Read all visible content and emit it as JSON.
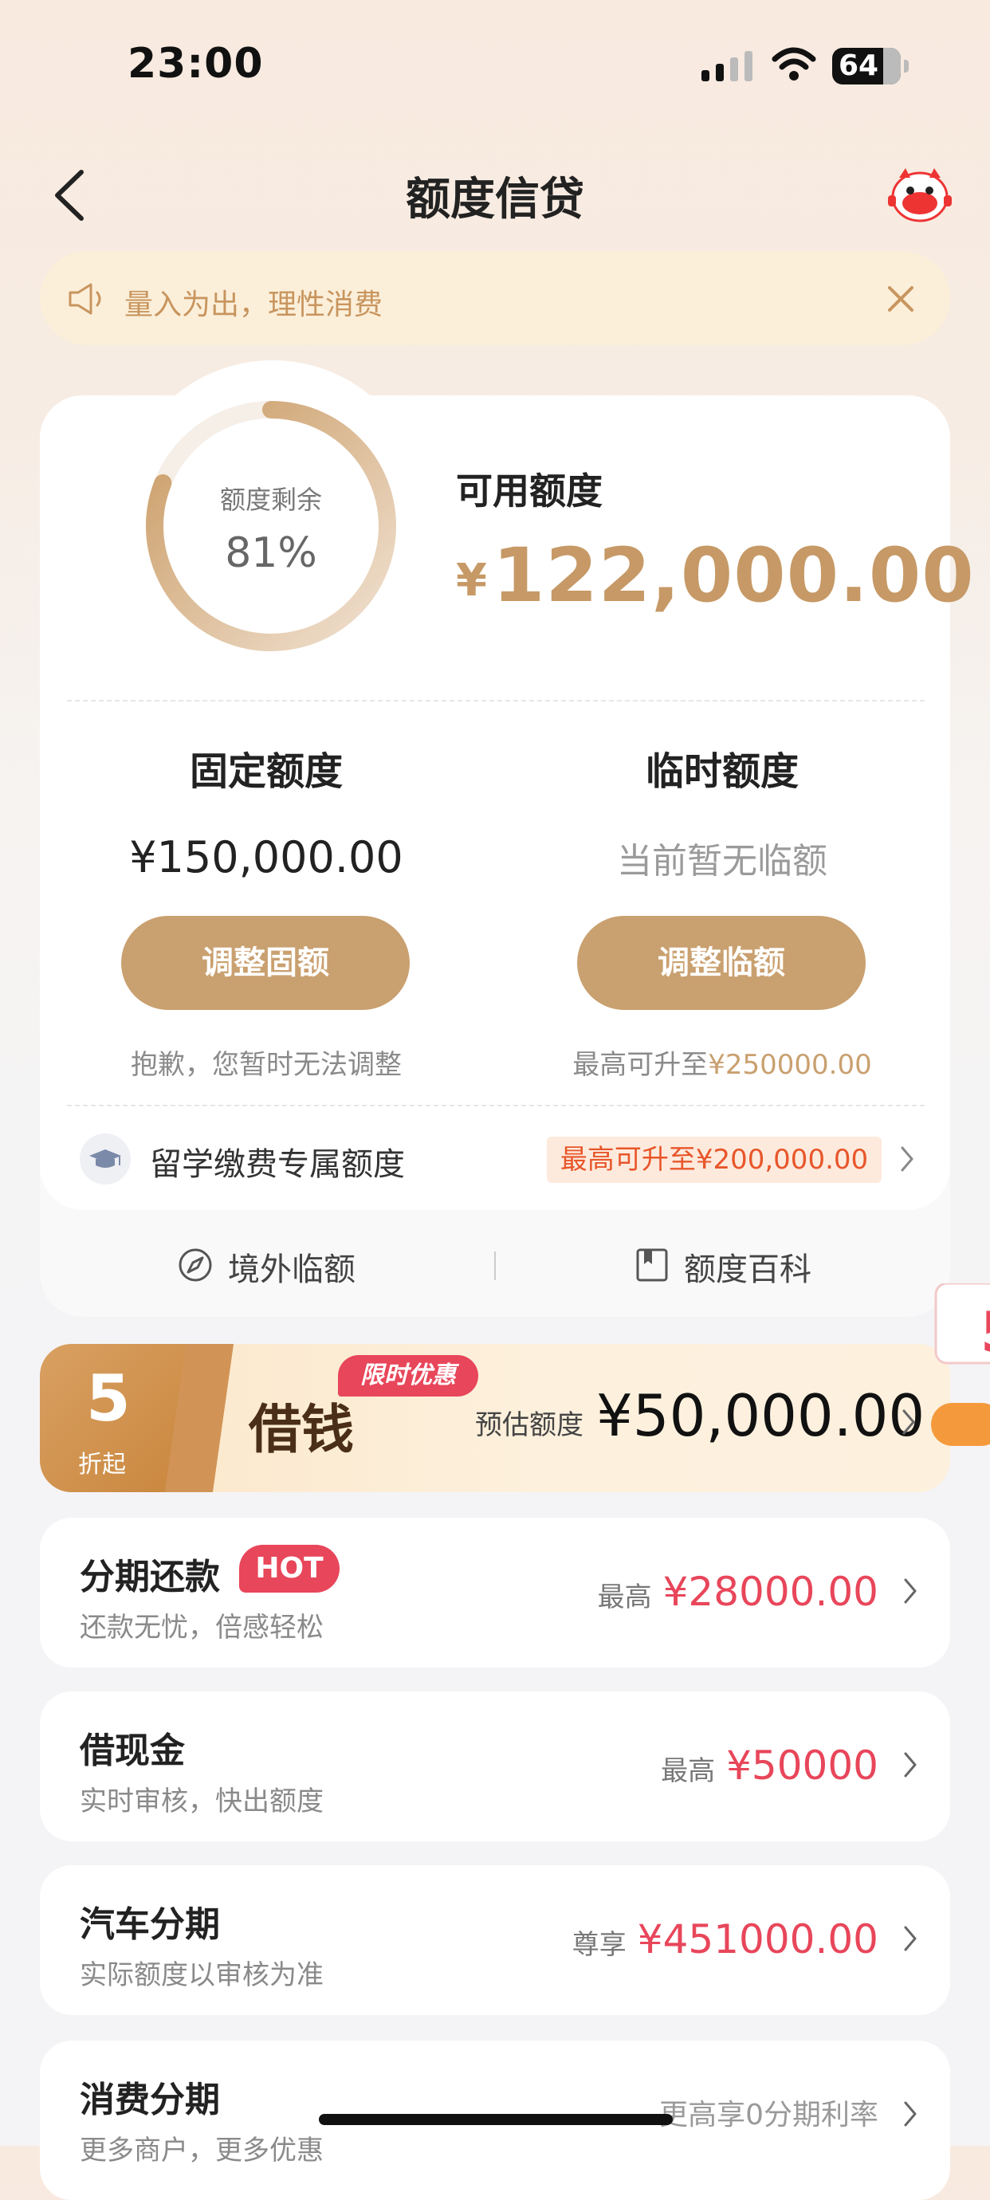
{
  "status_bar": {
    "time": "23:00",
    "battery": "64"
  },
  "nav": {
    "title": "额度信贷"
  },
  "notice": {
    "text": "量入为出，理性消费"
  },
  "credit": {
    "ring_label": "额度剩余",
    "ring_percent_text": "81%",
    "ring_percent": 0.81,
    "available_label": "可用额度",
    "available_currency": "¥",
    "available_amount": "122,000.00",
    "fixed_label": "固定额度",
    "fixed_amount": "¥150,000.00",
    "fixed_button": "调整固额",
    "fixed_note": "抱歉，您暂时无法调整",
    "temp_label": "临时额度",
    "temp_status": "当前暂无临额",
    "temp_button": "调整临额",
    "temp_note_prefix": "最高可升至",
    "temp_note_amount": "¥250000.00",
    "study_label": "留学缴费专属额度",
    "study_tag": "最高可升至¥200,000.00",
    "overseas_label": "境外临额",
    "wiki_label": "额度百科"
  },
  "promo": {
    "discount_num": "5",
    "discount_suffix": "折起",
    "tag": "限时优惠",
    "title": "借钱",
    "est_label": "预估额度",
    "est_amount": "¥50,000.00"
  },
  "products": [
    {
      "title": "分期还款",
      "badge": "HOT",
      "subtitle": "还款无忧，倍感轻松",
      "prefix": "最高",
      "amount": "¥28000.00"
    },
    {
      "title": "借现金",
      "subtitle": "实时审核，快出额度",
      "prefix": "最高",
      "amount": "¥50000"
    },
    {
      "title": "汽车分期",
      "subtitle": "实际额度以审核为准",
      "prefix": "尊享",
      "amount": "¥451000.00"
    },
    {
      "title": "消费分期",
      "subtitle": "更多商户，更多优惠",
      "right_text": "更高享0分期利率"
    }
  ],
  "colors": {
    "accent": "#c9a06f",
    "red": "#e8465a",
    "orange": "#e8562a"
  }
}
